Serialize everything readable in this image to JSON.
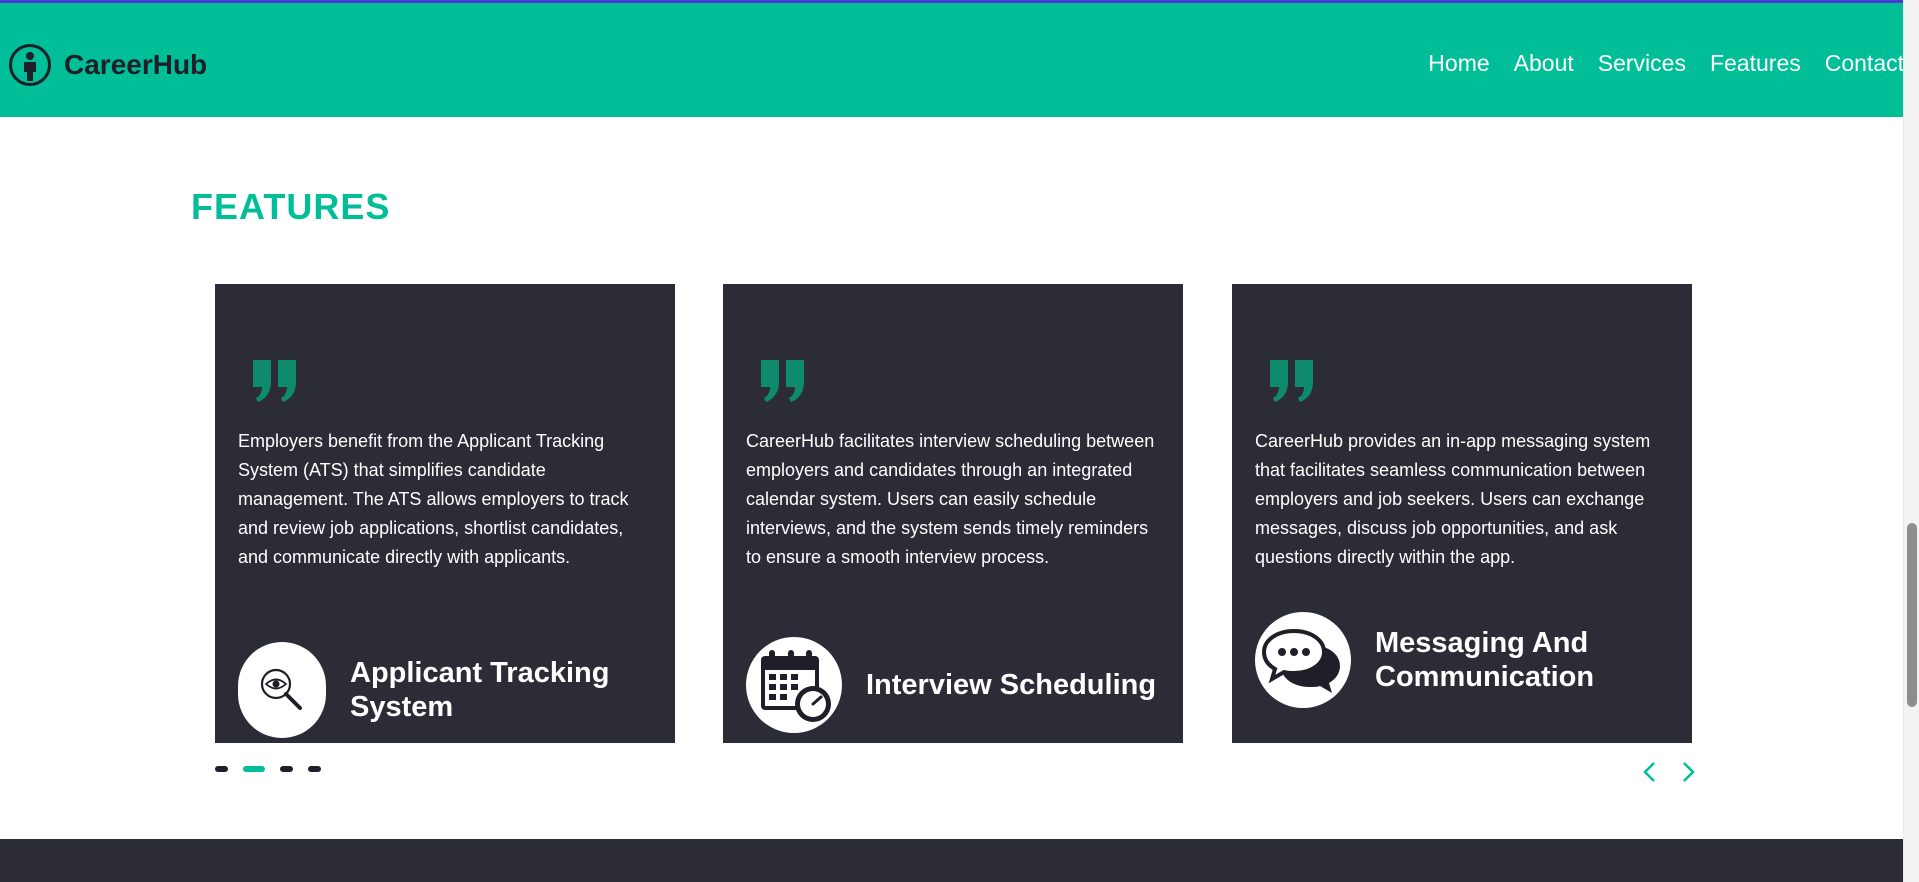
{
  "brand": {
    "name": "CareerHub",
    "icon": "person-circle-icon"
  },
  "nav": {
    "items": [
      {
        "label": "Home"
      },
      {
        "label": "About"
      },
      {
        "label": "Services"
      },
      {
        "label": "Features"
      },
      {
        "label": "Contact"
      }
    ]
  },
  "features": {
    "title": "FEATURES",
    "cards": [
      {
        "text": "Employers benefit from the Applicant Tracking System (ATS) that simplifies candidate management. The ATS allows employers to track and review job applications, shortlist candidates, and communicate directly with applicants.",
        "title": "Applicant Tracking System",
        "icon": "magnifier-eye-icon"
      },
      {
        "text": "CareerHub facilitates interview scheduling between employers and candidates through an integrated calendar system. Users can easily schedule interviews, and the system sends timely reminders to ensure a smooth interview process.",
        "title": "Interview Scheduling",
        "icon": "calendar-clock-icon"
      },
      {
        "text": "CareerHub provides an in-app messaging system that facilitates seamless communication between employers and job seekers. Users can exchange messages, discuss job opportunities, and ask questions directly within the app.",
        "title": "Messaging And Communication",
        "icon": "chat-bubbles-icon"
      }
    ],
    "carousel": {
      "slide_count": 4,
      "active_index": 1
    }
  },
  "colors": {
    "accent": "#00bf98",
    "card_bg": "#2c2c37",
    "dark": "#1e1f28"
  }
}
